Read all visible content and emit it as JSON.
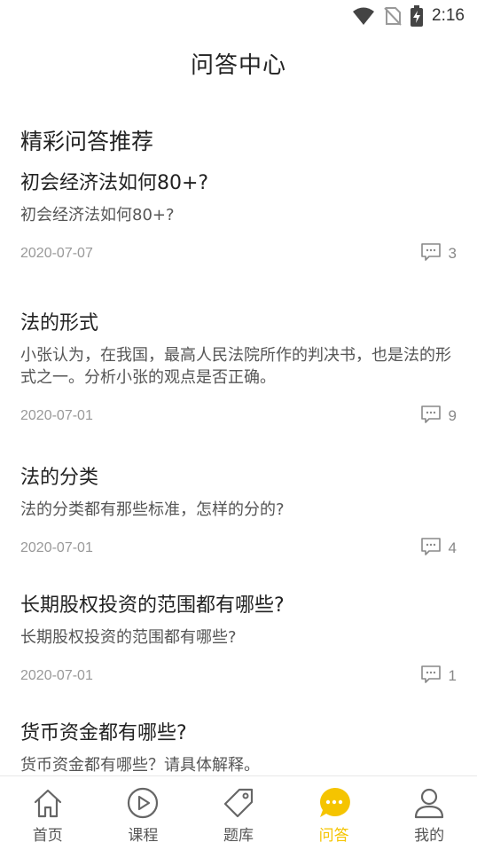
{
  "status_bar": {
    "time": "2:16"
  },
  "header": {
    "title": "问答中心"
  },
  "section": {
    "title": "精彩问答推荐"
  },
  "questions": [
    {
      "title": "初会经济法如何80+?",
      "description": "初会经济法如何80+?",
      "date": "2020-07-07",
      "comments": "3"
    },
    {
      "title": "法的形式",
      "description": "小张认为，在我国，最高人民法院所作的判决书，也是法的形式之一。分析小张的观点是否正确。",
      "date": "2020-07-01",
      "comments": "9"
    },
    {
      "title": "法的分类",
      "description": "法的分类都有那些标准，怎样的分的?",
      "date": "2020-07-01",
      "comments": "4"
    },
    {
      "title": "长期股权投资的范围都有哪些?",
      "description": "长期股权投资的范围都有哪些?",
      "date": "2020-07-01",
      "comments": "1"
    },
    {
      "title": "货币资金都有哪些?",
      "description": "货币资金都有哪些？请具体解释。",
      "date": "",
      "comments": ""
    }
  ],
  "nav": {
    "items": [
      {
        "label": "首页",
        "icon": "home-icon"
      },
      {
        "label": "课程",
        "icon": "play-icon"
      },
      {
        "label": "题库",
        "icon": "tag-icon"
      },
      {
        "label": "问答",
        "icon": "chat-bubble-icon"
      },
      {
        "label": "我的",
        "icon": "user-icon"
      }
    ],
    "active_color": "#f5c400"
  }
}
